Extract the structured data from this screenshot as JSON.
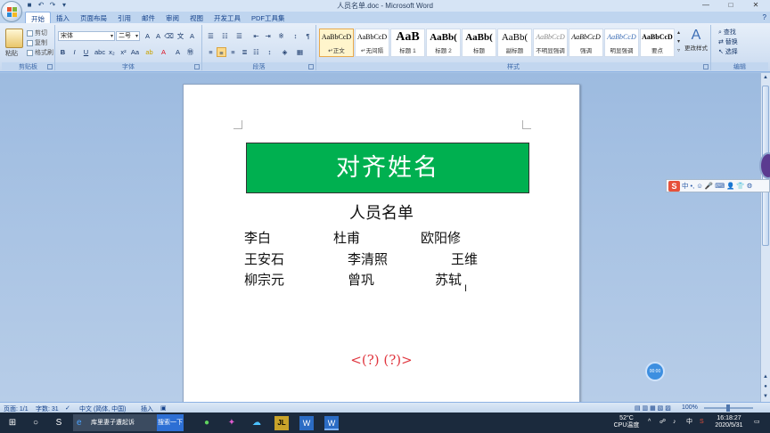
{
  "window": {
    "title": "人员名单.doc - Microsoft Word",
    "qat": [
      "save-icon",
      "undo-icon",
      "redo-icon",
      "customize-icon"
    ],
    "controls": {
      "minimize": "—",
      "maximize": "□",
      "close": "✕"
    }
  },
  "tabs": [
    "开始",
    "插入",
    "页面布局",
    "引用",
    "邮件",
    "审阅",
    "视图",
    "开发工具",
    "PDF工具集"
  ],
  "active_tab": "开始",
  "ribbon": {
    "clipboard": {
      "label": "剪贴板",
      "paste": "粘贴",
      "cut": "剪切",
      "copy": "复制",
      "format_painter": "格式刷"
    },
    "font": {
      "label": "字体",
      "name": "宋体",
      "size": "二号"
    },
    "paragraph": {
      "label": "段落"
    },
    "styles": {
      "label": "样式",
      "items": [
        {
          "sample": "AaBbCcD",
          "name": "↵正文"
        },
        {
          "sample": "AaBbCcD",
          "name": "↵无间隔"
        },
        {
          "sample": "AaB",
          "name": "标题 1"
        },
        {
          "sample": "AaBb(",
          "name": "标题 2"
        },
        {
          "sample": "AaBb(",
          "name": "标题"
        },
        {
          "sample": "AaBb(",
          "name": "副标题"
        },
        {
          "sample": "AaBbCcD",
          "name": "不明显强调"
        },
        {
          "sample": "AaBbCcD",
          "name": "强调"
        },
        {
          "sample": "AaBbCcD",
          "name": "明显强调"
        },
        {
          "sample": "AaBbCcD",
          "name": "要点"
        }
      ],
      "change_styles": "更改样式"
    },
    "editing": {
      "label": "编辑",
      "find": "查找",
      "replace": "替换",
      "select": "选择"
    }
  },
  "document": {
    "banner": "对齐姓名",
    "heading": "人员名单",
    "rows": [
      [
        "李白",
        "杜甫",
        "欧阳修"
      ],
      [
        "王安石",
        "李清照",
        "王维"
      ],
      [
        "柳宗元",
        "曾巩",
        "苏轼"
      ]
    ],
    "red_mark": "<(?) (?)>",
    "banner_color": "#00b050"
  },
  "ime": {
    "logo": "S",
    "mode": "中",
    "punct": "•,",
    "items": [
      "☺",
      "🎤",
      "⌨",
      "👤",
      "👕",
      "⚙"
    ]
  },
  "float_button": "00:00",
  "statusbar": {
    "page": "页面: 1/1",
    "words": "字数: 31",
    "language": "中文 (简体, 中国)",
    "mode": "插入",
    "zoom": "100%"
  },
  "taskbar": {
    "app_label": "库里妻子遭起诉",
    "search_label": "搜索一下",
    "temperature": "52°C",
    "cpu": "CPU温度",
    "time": "16:18:27",
    "date": "2020/5/31"
  }
}
